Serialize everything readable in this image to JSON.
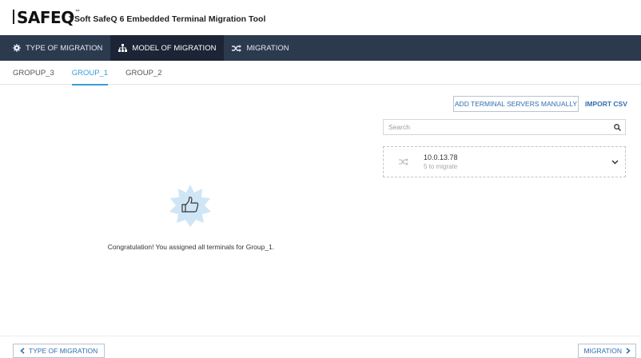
{
  "header": {
    "logo_text": "SAFEQ",
    "logo_tm": "™",
    "app_title": "YSoft SafeQ 6 Embedded Terminal Migration Tool"
  },
  "nav": {
    "items": [
      {
        "label": "TYPE OF MIGRATION",
        "icon": "gear-icon"
      },
      {
        "label": "MODEL OF MIGRATION",
        "icon": "sitemap-icon"
      },
      {
        "label": "MIGRATION",
        "icon": "shuffle-icon"
      }
    ],
    "active": "MODEL OF MIGRATION"
  },
  "groups": {
    "tabs": [
      "GROPUP_3",
      "GROUP_1",
      "GROUP_2"
    ],
    "active": "GROUP_1"
  },
  "actions": {
    "add_manual": "ADD TERMINAL SERVERS MANUALLY",
    "import_csv": "IMPORT CSV"
  },
  "search": {
    "placeholder": "Search",
    "value": ""
  },
  "server": {
    "ip": "10.0.13.78",
    "sub": "5 to migrate"
  },
  "empty_state": {
    "message": "Congratulation! You assigned all terminals for Group_1."
  },
  "footer": {
    "back": "TYPE OF MIGRATION",
    "next": "MIGRATION"
  },
  "colors": {
    "navbar": "#2c3a4e",
    "navbar_active": "#1b2535",
    "accent": "#3a9bd8",
    "link": "#2e6fb0",
    "badge": "#cfe6f6"
  }
}
